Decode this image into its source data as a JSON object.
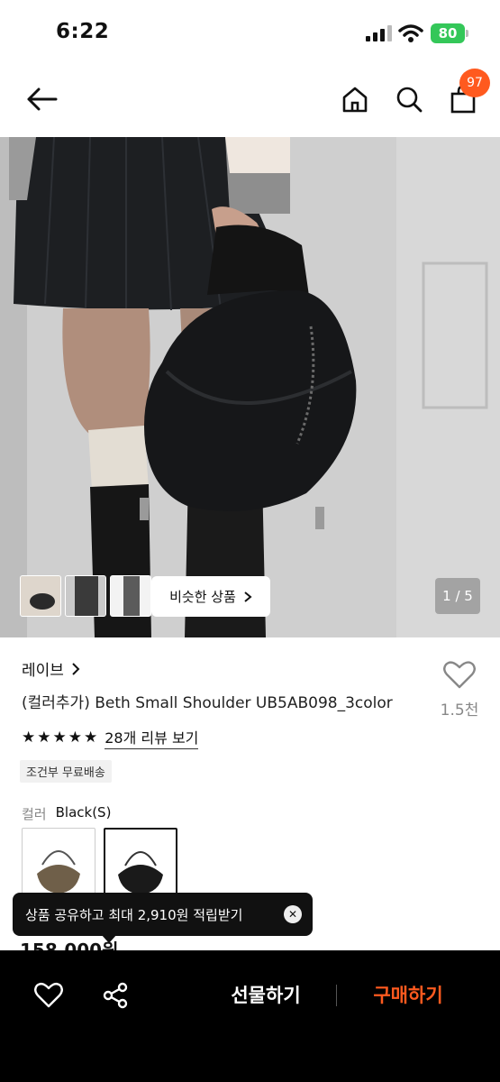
{
  "status": {
    "time": "6:22",
    "battery": "80"
  },
  "nav": {
    "cart_count": "97"
  },
  "gallery": {
    "similar_label": "비슷한 상품",
    "pager": "1 / 5"
  },
  "product": {
    "brand": "레이브",
    "title": "(컬러추가) Beth Small Shoulder UB5AB098_3color",
    "like_count": "1.5천",
    "rating": 5,
    "review_link": "28개 리뷰 보기",
    "shipping_badge": "조건부 무료배송",
    "color_label": "컬러",
    "color_value": "Black(S)",
    "price": "158,000원"
  },
  "toast": {
    "text": "상품 공유하고 최대 2,910원 적립받기"
  },
  "bottom_bar": {
    "gift_label": "선물하기",
    "buy_label": "구매하기"
  },
  "colors": {
    "accent": "#ff5a1f",
    "battery": "#34c759"
  }
}
